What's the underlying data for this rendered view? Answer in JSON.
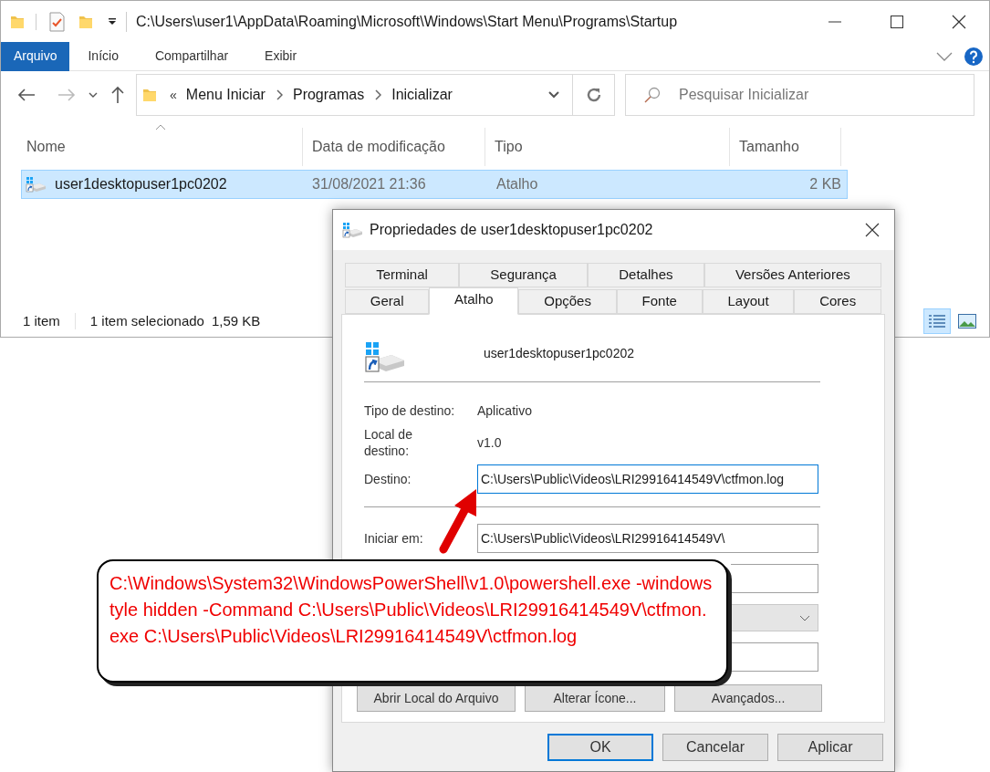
{
  "explorer": {
    "title_path": "C:\\Users\\user1\\AppData\\Roaming\\Microsoft\\Windows\\Start Menu\\Programs\\Startup",
    "ribbon_tabs": [
      {
        "label": "Arquivo",
        "selected": true
      },
      {
        "label": "Início",
        "selected": false
      },
      {
        "label": "Compartilhar",
        "selected": false
      },
      {
        "label": "Exibir",
        "selected": false
      }
    ],
    "breadcrumb": {
      "overflow": "«",
      "segments": [
        "Menu Iniciar",
        "Programas",
        "Inicializar"
      ]
    },
    "search": {
      "placeholder": "Pesquisar Inicializar"
    },
    "columns": [
      "Nome",
      "Data de modificação",
      "Tipo",
      "Tamanho"
    ],
    "rows": [
      {
        "name": "user1desktopuser1pc0202",
        "modified": "31/08/2021 21:36",
        "type": "Atalho",
        "size": "2 KB",
        "selected": true
      }
    ],
    "status_bar": {
      "count": "1 item",
      "selection": "1 item selecionado",
      "size": "1,59 KB"
    }
  },
  "dialog": {
    "title": "Propriedades de user1desktopuser1pc0202",
    "tabs_back": [
      {
        "label": "Terminal",
        "selected": false
      },
      {
        "label": "Segurança",
        "selected": false
      },
      {
        "label": "Detalhes",
        "selected": false
      },
      {
        "label": "Versões Anteriores",
        "selected": false
      }
    ],
    "tabs_front": [
      {
        "label": "Geral",
        "selected": false
      },
      {
        "label": "Atalho",
        "selected": true
      },
      {
        "label": "Opções",
        "selected": false
      },
      {
        "label": "Fonte",
        "selected": false
      },
      {
        "label": "Layout",
        "selected": false
      },
      {
        "label": "Cores",
        "selected": false
      }
    ],
    "shortcut_name": "user1desktopuser1pc0202",
    "fields": [
      {
        "kind": "info",
        "label": "Tipo de destino:",
        "value": "Aplicativo"
      },
      {
        "kind": "info",
        "label": "Local de\ndestino:",
        "value": "v1.0"
      },
      {
        "kind": "input",
        "label": "Destino:",
        "value": "C:\\Users\\Public\\Videos\\LRI29916414549V\\ctfmon.log",
        "focused": true
      },
      {
        "kind": "divider"
      },
      {
        "kind": "input",
        "label": "Iniciar em:",
        "value": "C:\\Users\\Public\\Videos\\LRI29916414549V\\",
        "focused": false
      },
      {
        "kind": "input",
        "focused": false
      },
      {
        "kind": "select"
      },
      {
        "kind": "input",
        "focused": false
      }
    ],
    "action_buttons": [
      "Abrir Local do Arquivo",
      "Alterar Ícone...",
      "Avançados..."
    ],
    "footer_buttons": [
      {
        "label": "OK",
        "default": true
      },
      {
        "label": "Cancelar",
        "default": false
      },
      {
        "label": "Aplicar",
        "default": false
      }
    ]
  },
  "callout": {
    "text": "C:\\Windows\\System32\\WindowsPowerShell\\v1.0\\powershell.exe -windowstyle hidden -Command C:\\Users\\Public\\Videos\\LRI29916414549V\\ctfmon.exe C:\\Users\\Public\\Videos\\LRI29916414549V\\ctfmon.log"
  }
}
